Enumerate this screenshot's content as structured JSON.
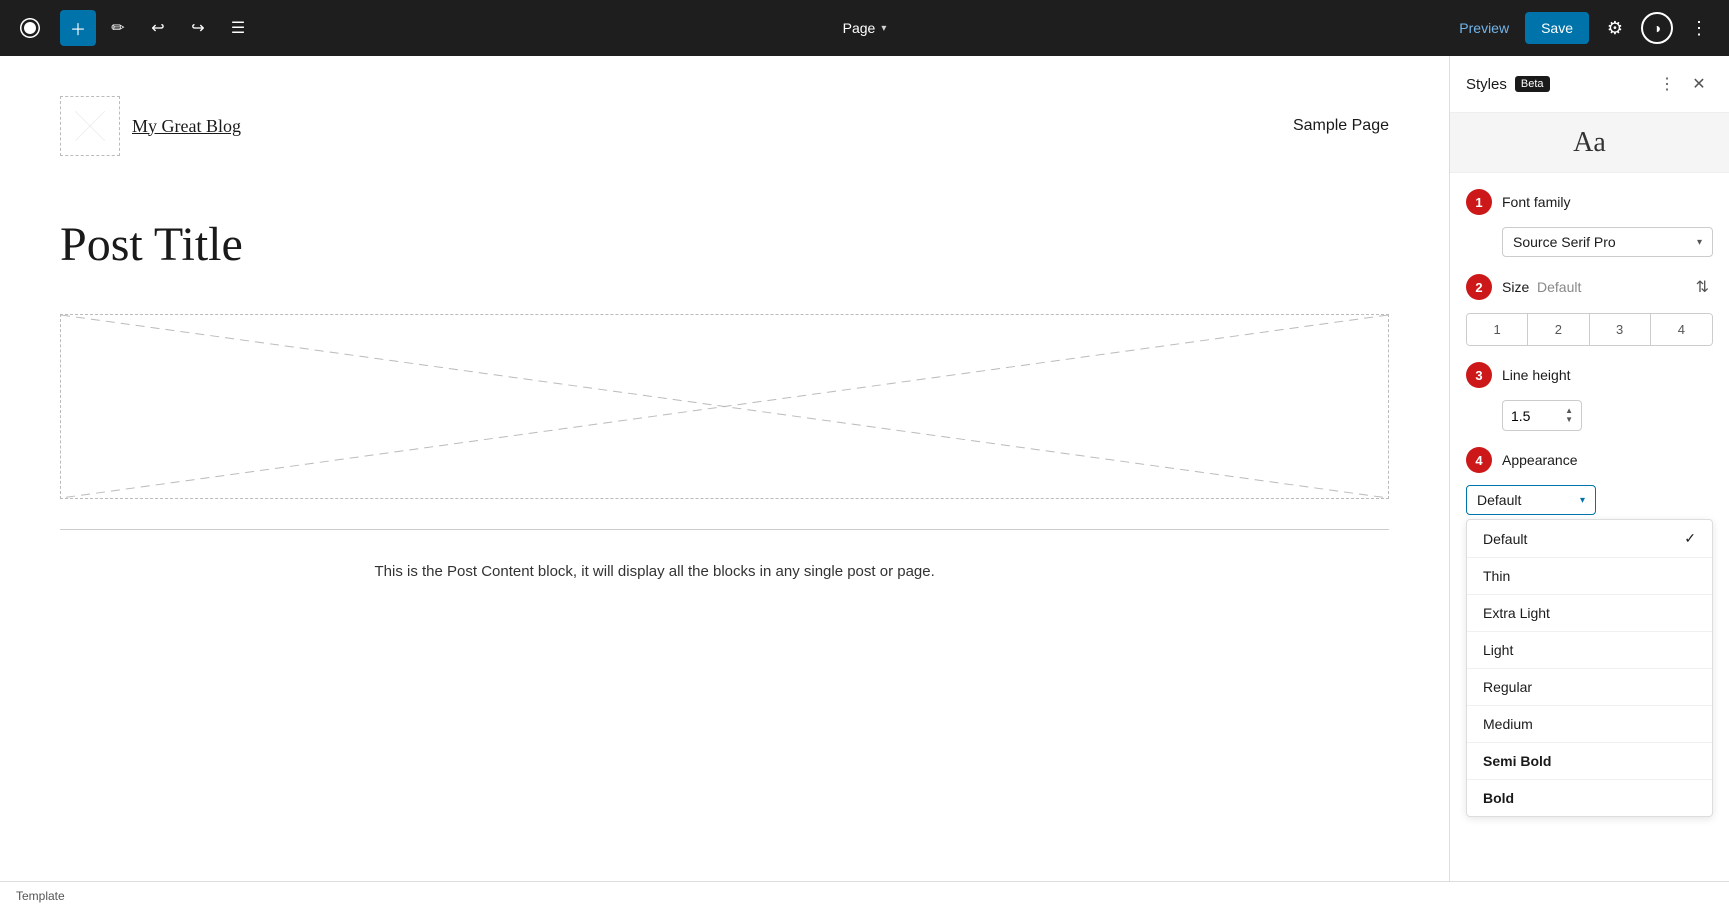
{
  "toolbar": {
    "page_label": "Page",
    "preview_label": "Preview",
    "save_label": "Save"
  },
  "canvas": {
    "blog_title": "My Great Blog",
    "nav_link": "Sample Page",
    "post_title": "Post Title",
    "post_content": "This is the Post Content block, it will display all the blocks in any single post or page."
  },
  "status_bar": {
    "template_label": "Template"
  },
  "sidebar": {
    "title": "Styles",
    "beta_label": "Beta",
    "preview_char": "Aa",
    "sections": [
      {
        "step": "1",
        "label": "Font family",
        "value": "Source Serif Pro"
      },
      {
        "step": "2",
        "label": "Size",
        "default_text": "Default",
        "size_options": [
          "1",
          "2",
          "3",
          "4"
        ]
      },
      {
        "step": "3",
        "label": "Line height",
        "value": "1.5"
      },
      {
        "step": "4",
        "label": "Appearance",
        "value": "Default"
      }
    ],
    "appearance_options": [
      {
        "label": "Default",
        "active": true
      },
      {
        "label": "Thin",
        "active": false
      },
      {
        "label": "Extra Light",
        "active": false
      },
      {
        "label": "Light",
        "active": false
      },
      {
        "label": "Regular",
        "active": false
      },
      {
        "label": "Medium",
        "active": false
      },
      {
        "label": "Semi Bold",
        "active": false
      },
      {
        "label": "Bold",
        "active": false
      }
    ]
  }
}
